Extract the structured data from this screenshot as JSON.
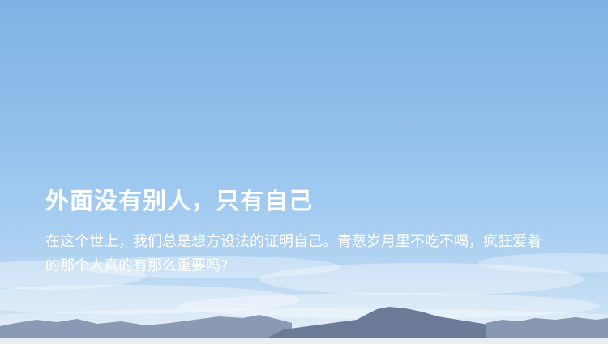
{
  "hero": {
    "headline": "外面没有别人，只有自己",
    "body": "在这个世上，我们总是想方设法的证明自己。青葱岁月里不吃不喝，疯狂爱着的那个人真的有那么重要吗?"
  },
  "background": {
    "sky_top": "#7fb3e3",
    "sky_bottom": "#dbe9f5",
    "mountain_color": "#6b7a96",
    "ground_color": "#e9eef3"
  }
}
